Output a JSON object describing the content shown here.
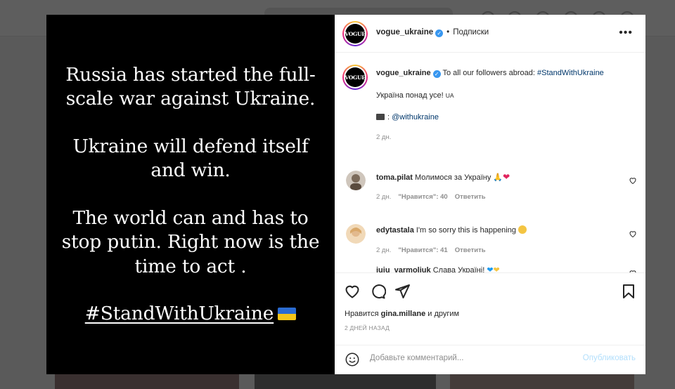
{
  "media": {
    "paragraphs": [
      "Russia has started the full-scale war against Ukraine.",
      "Ukraine will defend itself and win.",
      "The world can and has to stop putin.  Right now is the time to act ."
    ],
    "hashtag": "#StandWithUkraine"
  },
  "header": {
    "username": "vogue_ukraine",
    "separator": "•",
    "following": "Подписки",
    "more": "•••",
    "logo_text": "VOGUE"
  },
  "caption": {
    "username": "vogue_ukraine",
    "text": "To all our followers abroad:",
    "hashtag": "#StandWithUkraine",
    "line2": "Україна понад усе!",
    "line2_suffix": "UA",
    "line3_mention": "@withukraine",
    "time": "2 дн."
  },
  "comments": [
    {
      "username": "toma.pilat",
      "text": "Молимося за Україну",
      "time": "2 дн.",
      "likes": "\"Нравится\": 40",
      "reply": "Ответить",
      "avatar": "#8a7a6a"
    },
    {
      "username": "edytastala",
      "text": "I'm so sorry this is happening",
      "time": "2 дн.",
      "likes": "\"Нравится\": 41",
      "reply": "Ответить",
      "avatar": "#d9b48a"
    },
    {
      "username": "iuiu_varmoliuk",
      "text": "Слава Україні!",
      "avatar": "#c9a07a"
    }
  ],
  "actions": {
    "likes_prefix": "Нравится",
    "likes_user": "gina.millane",
    "likes_suffix": "и другим",
    "date": "2 ДНЕЙ НАЗАД"
  },
  "composer": {
    "placeholder": "Добавьте комментарий...",
    "publish": "Опубликовать"
  }
}
